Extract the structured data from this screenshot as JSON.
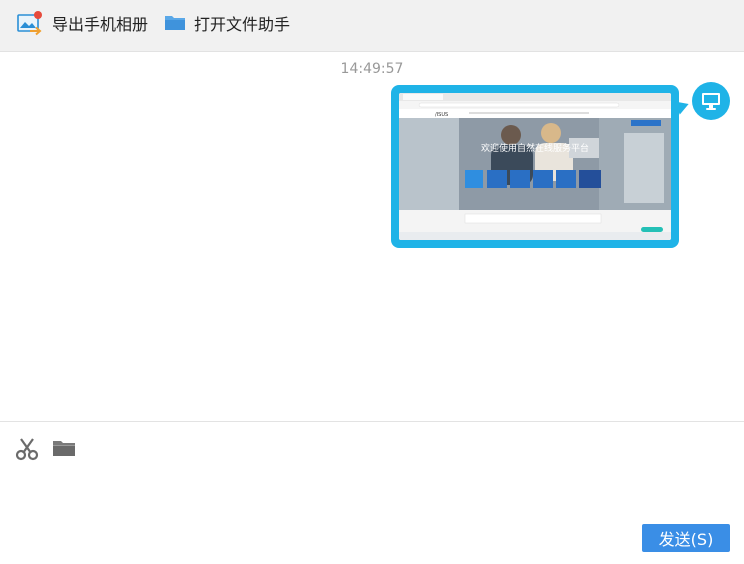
{
  "toolbar": {
    "export_album_label": "导出手机相册",
    "open_file_helper_label": "打开文件助手"
  },
  "chat": {
    "timestamp": "14:49:57",
    "message": {
      "type": "image",
      "thumbnail": {
        "site_logo": "/ISUS",
        "hero_title": "欢迎使用自然在线服务平台"
      }
    }
  },
  "input": {
    "send_label": "发送(S)"
  },
  "colors": {
    "accent": "#1fb3e7",
    "send_button": "#3a8ee6",
    "toolbar_bg": "#f1f1f1"
  },
  "icons": [
    "album-export-icon",
    "folder-icon",
    "computer-avatar-icon",
    "scissors-icon",
    "open-folder-icon"
  ]
}
